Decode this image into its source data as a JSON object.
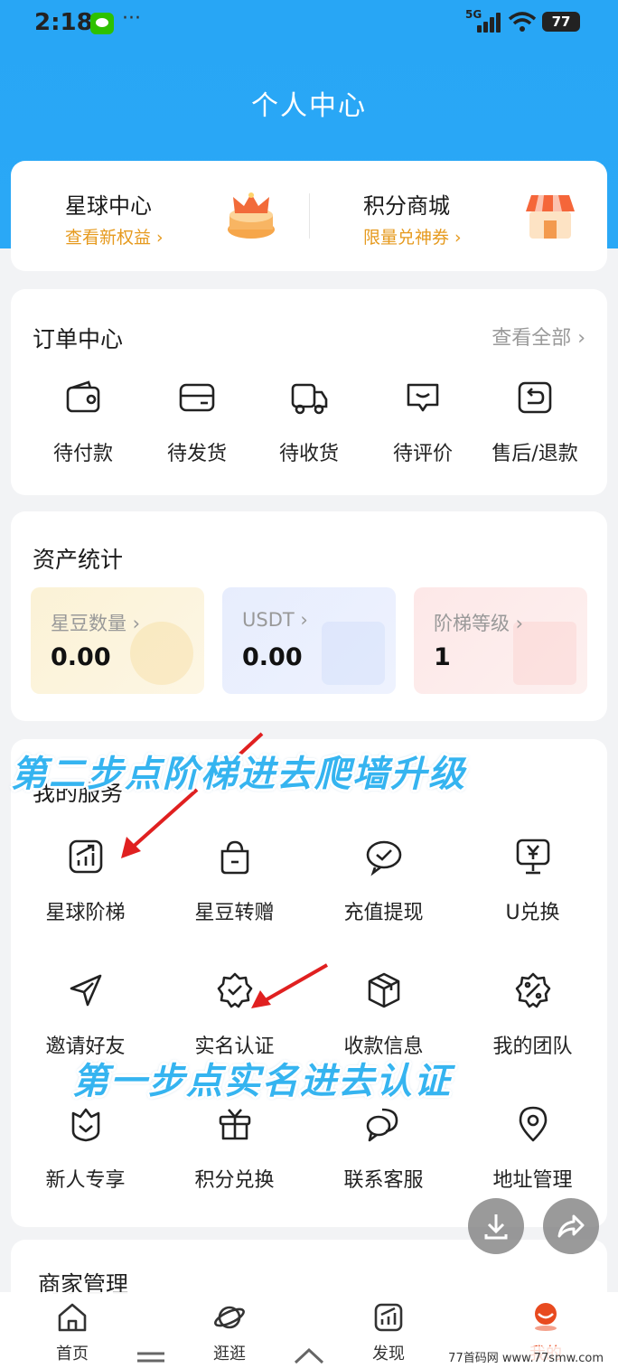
{
  "status_bar": {
    "time": "2:18",
    "dots": "···",
    "network": "5G",
    "battery": "77"
  },
  "header": {
    "title": "个人中心"
  },
  "promo": [
    {
      "title": "星球中心",
      "subtitle": "查看新权益 ›",
      "icon": "crown-icon"
    },
    {
      "title": "积分商城",
      "subtitle": "限量兑神券 ›",
      "icon": "shop-icon"
    }
  ],
  "orders": {
    "title": "订单中心",
    "view_all": "查看全部 ›",
    "items": [
      {
        "label": "待付款",
        "icon": "wallet-icon"
      },
      {
        "label": "待发货",
        "icon": "card-icon"
      },
      {
        "label": "待收货",
        "icon": "truck-icon"
      },
      {
        "label": "待评价",
        "icon": "comment-icon"
      },
      {
        "label": "售后/退款",
        "icon": "return-icon"
      }
    ]
  },
  "assets": {
    "title": "资产统计",
    "tiles": [
      {
        "label": "星豆数量 ›",
        "value": "0.00"
      },
      {
        "label": "USDT ›",
        "value": "0.00"
      },
      {
        "label": "阶梯等级 ›",
        "value": "1"
      }
    ]
  },
  "services": {
    "title": "我的服务",
    "items": [
      {
        "label": "星球阶梯",
        "icon": "chart-icon"
      },
      {
        "label": "星豆转赠",
        "icon": "bag-icon"
      },
      {
        "label": "充值提现",
        "icon": "check-bubble-icon"
      },
      {
        "label": "U兑换",
        "icon": "yen-screen-icon"
      },
      {
        "label": "邀请好友",
        "icon": "send-icon"
      },
      {
        "label": "实名认证",
        "icon": "badge-check-icon"
      },
      {
        "label": "收款信息",
        "icon": "box-icon"
      },
      {
        "label": "我的团队",
        "icon": "percent-badge-icon"
      },
      {
        "label": "新人专享",
        "icon": "shield-heart-icon"
      },
      {
        "label": "积分兑换",
        "icon": "gift-icon"
      },
      {
        "label": "联系客服",
        "icon": "chat-icon"
      },
      {
        "label": "地址管理",
        "icon": "location-icon"
      }
    ]
  },
  "merchant": {
    "title": "商家管理"
  },
  "annotations": {
    "step2": "第二步点阶梯进去爬墙升级",
    "step1": "第一步点实名进去认证"
  },
  "tabs": [
    {
      "label": "首页",
      "icon": "home-icon"
    },
    {
      "label": "逛逛",
      "icon": "planet-icon"
    },
    {
      "label": "发现",
      "icon": "trend-icon"
    },
    {
      "label": "我的",
      "icon": "profile-icon"
    }
  ],
  "watermark": "77首码网 www.77smw.com",
  "colors": {
    "header_blue": "#28a6f5",
    "accent_orange": "#e69a1e",
    "active_tab": "#e84a1f",
    "overlay_text": "#35b4f0"
  }
}
